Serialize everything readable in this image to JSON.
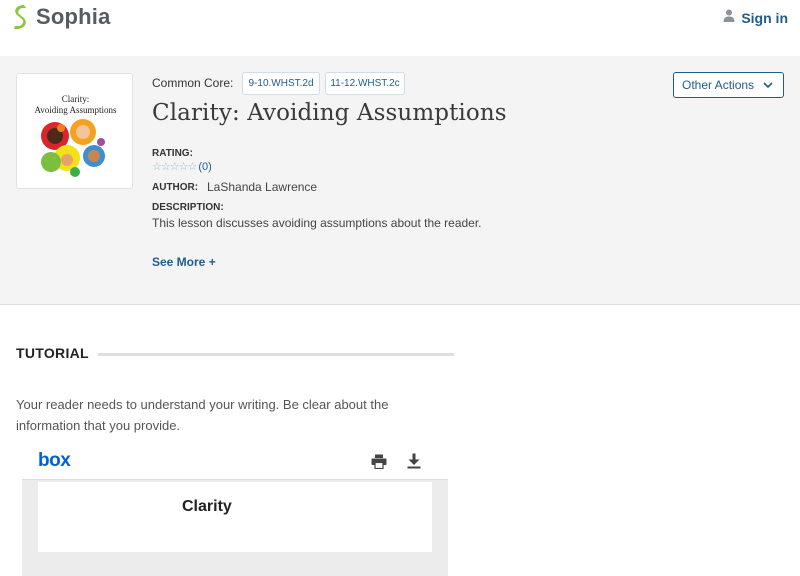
{
  "header": {
    "logo_text": "Sophia",
    "signin_label": "Sign in"
  },
  "lesson": {
    "thumbnail_title_line1": "Clarity:",
    "thumbnail_title_line2": "Avoiding Assumptions",
    "common_core_label": "Common Core:",
    "standards": [
      "9-10.WHST.2d",
      "11-12.WHST.2c"
    ],
    "title": "Clarity: Avoiding Assumptions",
    "other_actions_label": "Other Actions",
    "rating_label": "RATING:",
    "rating_stars": "☆☆☆☆☆",
    "rating_count": "(0)",
    "author_label": "AUTHOR:",
    "author_name": "LaShanda Lawrence",
    "description_label": "DESCRIPTION:",
    "description": "This lesson discusses avoiding assumptions about the reader.",
    "see_more_label": "See More +"
  },
  "tutorial": {
    "heading": "TUTORIAL",
    "intro": "Your reader needs to understand your writing. Be clear about the information that you provide."
  },
  "box_embed": {
    "logo": "box",
    "page_text": "Clarity"
  },
  "colors": {
    "brand_green": "#8cc63f",
    "link_blue": "#1f5c8a",
    "panel_bg": "#f4f4f4",
    "box_blue": "#0061d5"
  },
  "icons": {
    "logo": "sophia-logo-icon",
    "user": "user-icon",
    "chevron": "chevron-down-icon",
    "print": "print-icon",
    "download": "download-icon"
  }
}
